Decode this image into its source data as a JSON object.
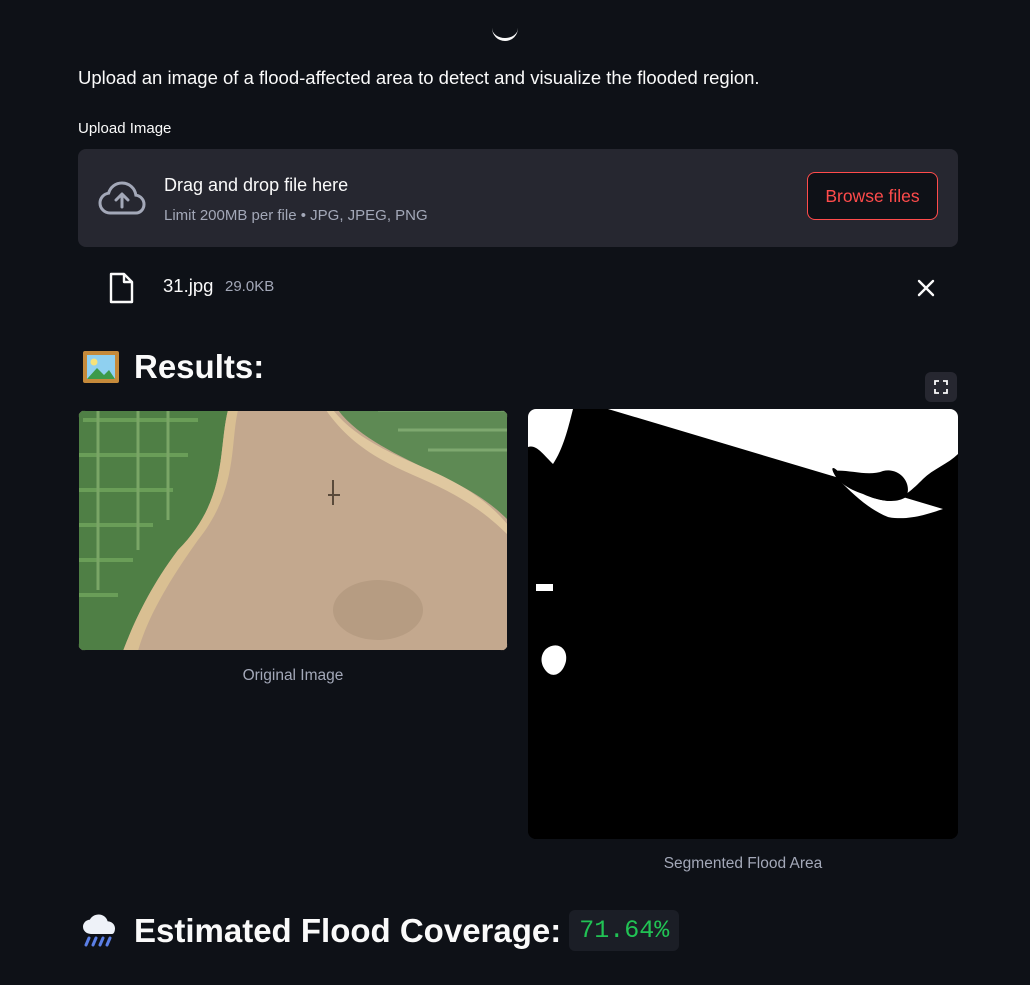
{
  "description": "Upload an image of a flood-affected area to detect and visualize the flooded region.",
  "uploader": {
    "label": "Upload Image",
    "drop_title": "Drag and drop file here",
    "drop_limit": "Limit 200MB per file • JPG, JPEG, PNG",
    "browse_label": "Browse files"
  },
  "uploaded_file": {
    "name": "31.jpg",
    "size": "29.0KB"
  },
  "results": {
    "heading": "Results:",
    "original_caption": "Original Image",
    "segmented_caption": "Segmented Flood Area"
  },
  "coverage": {
    "heading": "Estimated Flood Coverage:",
    "value": "71.64%"
  },
  "colors": {
    "background": "#0e1117",
    "panel": "#262730",
    "accent": "#ff4b4b",
    "success": "#21c354",
    "muted_text": "#a3a8b8"
  },
  "icons": [
    "cloud-upload-icon",
    "file-icon",
    "close-icon",
    "picture-icon",
    "fullscreen-icon",
    "rain-cloud-icon"
  ]
}
